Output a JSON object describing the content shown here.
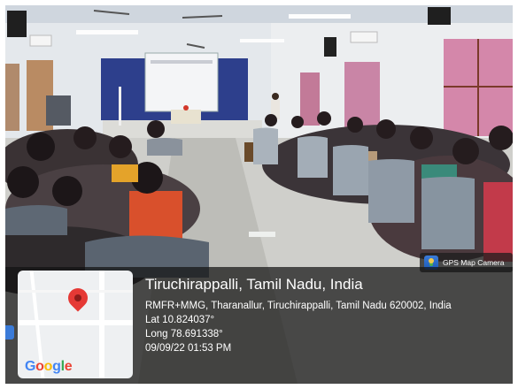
{
  "watermark": {
    "app_label": "GPS Map Camera",
    "icon": "gps-map-camera-icon"
  },
  "location": {
    "city": "Tiruchirappalli, Tamil Nadu, India",
    "address": "RMFR+MMG, Tharanallur, Tiruchirappalli, Tamil Nadu 620002, India",
    "lat": "Lat 10.824037°",
    "long": "Long 78.691338°",
    "datetime": "09/09/22 01:53 PM"
  },
  "map": {
    "brand": "Google",
    "pin_color": "#e53935"
  },
  "scene": {
    "description_icon": "classroom-photo"
  }
}
